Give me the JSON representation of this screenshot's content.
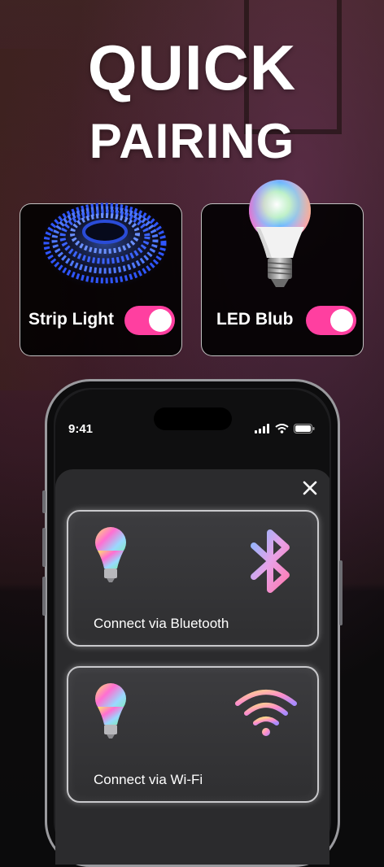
{
  "hero": {
    "line1": "QUICK",
    "line2": "PAIRING"
  },
  "devices": [
    {
      "label": "Strip Light",
      "toggle_on": true
    },
    {
      "label": "LED Blub",
      "toggle_on": true
    }
  ],
  "phone": {
    "status_time": "9:41",
    "options": [
      {
        "label": "Connect via Bluetooth",
        "icon": "bluetooth-icon"
      },
      {
        "label": "Connect via Wi-Fi",
        "icon": "wifi-icon"
      }
    ]
  },
  "colors": {
    "toggle_accent": "#ff3fa0",
    "card_bg": "#000000",
    "sheet_bg": "#2b2b2d"
  }
}
